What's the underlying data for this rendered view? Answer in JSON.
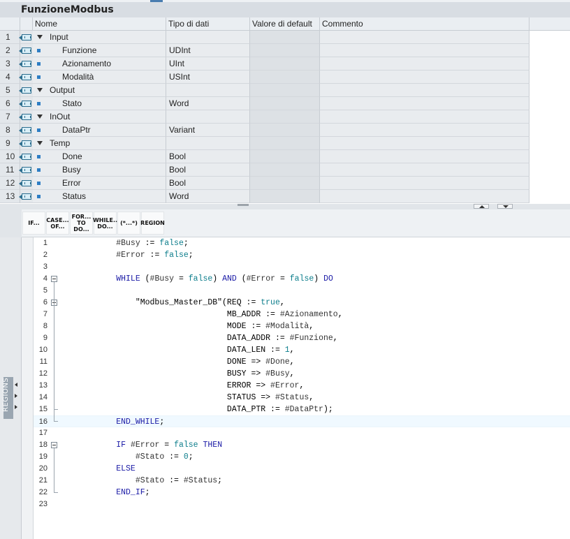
{
  "block": {
    "title": "FunzioneModbus"
  },
  "table": {
    "headers": [
      "Nome",
      "Tipo di dati",
      "Valore di default",
      "Commento"
    ],
    "rows": [
      {
        "num": "1",
        "name": "Input",
        "type": "",
        "section": true
      },
      {
        "num": "2",
        "name": "Funzione",
        "type": "UDInt",
        "section": false
      },
      {
        "num": "3",
        "name": "Azionamento",
        "type": "UInt",
        "section": false
      },
      {
        "num": "4",
        "name": "Modalità",
        "type": "USInt",
        "section": false
      },
      {
        "num": "5",
        "name": "Output",
        "type": "",
        "section": true
      },
      {
        "num": "6",
        "name": "Stato",
        "type": "Word",
        "section": false
      },
      {
        "num": "7",
        "name": "InOut",
        "type": "",
        "section": true
      },
      {
        "num": "8",
        "name": "DataPtr",
        "type": "Variant",
        "section": false
      },
      {
        "num": "9",
        "name": "Temp",
        "type": "",
        "section": true
      },
      {
        "num": "10",
        "name": "Done",
        "type": "Bool",
        "section": false
      },
      {
        "num": "11",
        "name": "Busy",
        "type": "Bool",
        "section": false
      },
      {
        "num": "12",
        "name": "Error",
        "type": "Bool",
        "section": false
      },
      {
        "num": "13",
        "name": "Status",
        "type": "Word",
        "section": false
      }
    ]
  },
  "toolbar": {
    "buttons": [
      {
        "line1": "IF...",
        "line2": ""
      },
      {
        "line1": "CASE...",
        "line2": "OF..."
      },
      {
        "line1": "FOR...",
        "line2": "TO DO..."
      },
      {
        "line1": "WHILE..",
        "line2": "DO..."
      },
      {
        "line1": "(*...*)",
        "line2": ""
      },
      {
        "line1": "REGION",
        "line2": ""
      }
    ]
  },
  "sidebar": {
    "label": "REGIONS"
  },
  "code": {
    "lines": [
      "        #Busy := false;",
      "        #Error := false;",
      "",
      "        WHILE (#Busy = false) AND (#Error = false) DO",
      "",
      "            \"Modbus_Master_DB\"(REQ := true,",
      "                               MB_ADDR := #Azionamento,",
      "                               MODE := #Modalità,",
      "                               DATA_ADDR := #Funzione,",
      "                               DATA_LEN := 1,",
      "                               DONE => #Done,",
      "                               BUSY => #Busy,",
      "                               ERROR => #Error,",
      "                               STATUS => #Status,",
      "                               DATA_PTR := #DataPtr);",
      "        END_WHILE;",
      "",
      "        IF #Error = false THEN",
      "            #Stato := 0;",
      "        ELSE",
      "            #Stato := #Status;",
      "        END_IF;",
      ""
    ],
    "highlighted_line": 16
  }
}
